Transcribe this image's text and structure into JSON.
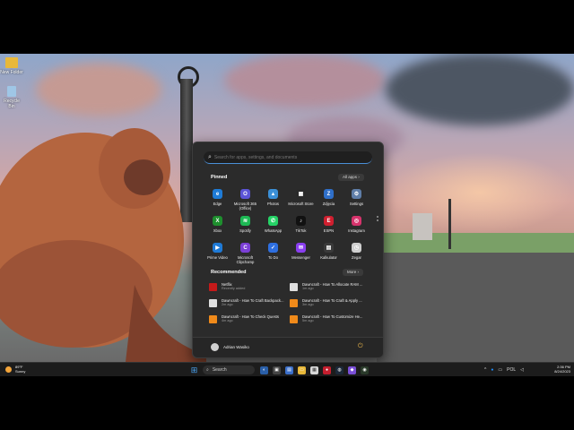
{
  "desktop": {
    "icons": [
      {
        "label": "New Folder",
        "icon": "folder-icon"
      },
      {
        "label": "Recycle Bin",
        "icon": "recycle-bin-icon"
      }
    ]
  },
  "start_menu": {
    "search_placeholder": "Search for apps, settings, and documents",
    "pinned_title": "Pinned",
    "all_apps_label": "All apps  ›",
    "pinned": [
      {
        "label": "Edge",
        "color": "#1e7bd6",
        "glyph": "e"
      },
      {
        "label": "Microsoft 365 (Office)",
        "color": "#5b54d6",
        "glyph": "O"
      },
      {
        "label": "Photos",
        "color": "#3b8fd6",
        "glyph": "▲"
      },
      {
        "label": "Microsoft Store",
        "color": "#2a2a2a",
        "glyph": "▦"
      },
      {
        "label": "Zdjęcia",
        "color": "#2f6fc9",
        "glyph": "Z"
      },
      {
        "label": "Settings",
        "color": "#5f7ea8",
        "glyph": "⚙"
      },
      {
        "label": "Xbox",
        "color": "#1e8f2e",
        "glyph": "X"
      },
      {
        "label": "Spotify",
        "color": "#1db954",
        "glyph": "≋"
      },
      {
        "label": "WhatsApp",
        "color": "#25d366",
        "glyph": "✆"
      },
      {
        "label": "TikTok",
        "color": "#111111",
        "glyph": "♪"
      },
      {
        "label": "ESPN",
        "color": "#d01f2f",
        "glyph": "E"
      },
      {
        "label": "Instagram",
        "color": "#d6336c",
        "glyph": "◎"
      },
      {
        "label": "Prime Video",
        "color": "#1f7ad6",
        "glyph": "▶"
      },
      {
        "label": "Microsoft Clipchamp",
        "color": "#7b3fd6",
        "glyph": "C"
      },
      {
        "label": "To Do",
        "color": "#2e6fe0",
        "glyph": "✓"
      },
      {
        "label": "Messenger",
        "color": "#8a3ef0",
        "glyph": "✉"
      },
      {
        "label": "Kalkulator",
        "color": "#3a3a3a",
        "glyph": "▤"
      },
      {
        "label": "Zegar",
        "color": "#cfcfcf",
        "glyph": "◷"
      }
    ],
    "recommended_title": "Recommended",
    "more_label": "More  ›",
    "recommended": [
      {
        "title": "Netflix",
        "sub": "Recently added",
        "color": "#c51a1a"
      },
      {
        "title": "Dawncraft - How To Allocate RAM ...",
        "sub": "1m ago",
        "color": "#e0e0e0"
      },
      {
        "title": "Dawncraft - How To Craft Backpack...",
        "sub": "2m ago",
        "color": "#e0e0e0"
      },
      {
        "title": "Dawncraft - How To Craft & Apply ...",
        "sub": "3m ago",
        "color": "#f08a1a"
      },
      {
        "title": "Dawncraft - How To Check Quests",
        "sub": "4m ago",
        "color": "#f08a1a"
      },
      {
        "title": "Dawncraft - How To Customize He...",
        "sub": "5m ago",
        "color": "#f08a1a"
      }
    ],
    "user_name": "Adrian Wasiko"
  },
  "taskbar": {
    "weather_temp": "89°F",
    "weather_desc": "Sunny",
    "search_label": "Search",
    "language": "POL",
    "time": "2:36 PM",
    "date": "8/24/2023"
  }
}
